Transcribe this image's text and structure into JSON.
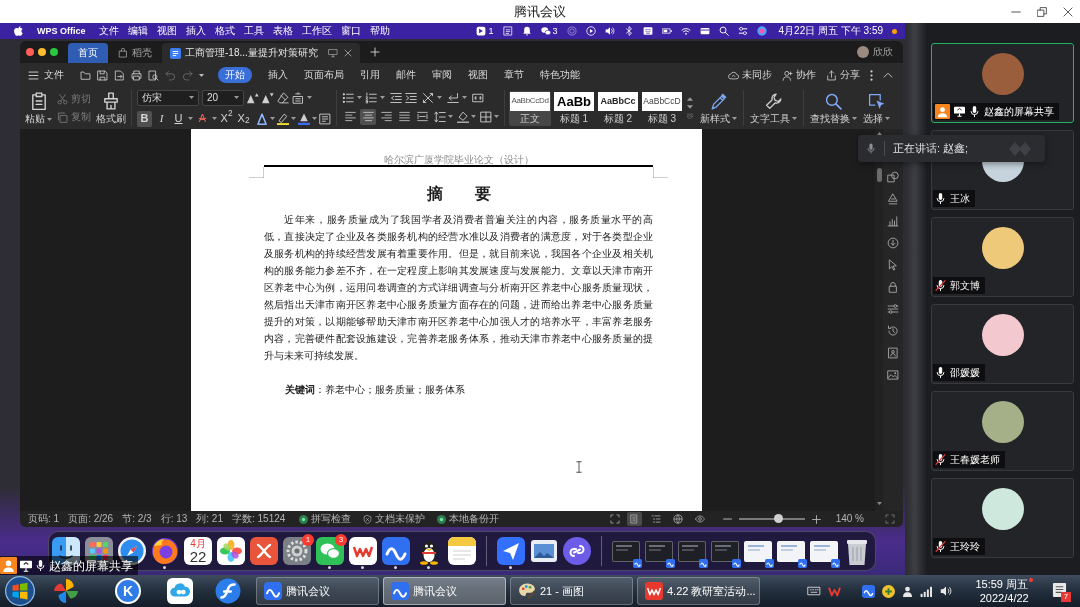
{
  "window": {
    "title": "腾讯会议"
  },
  "mac_menu_bar": {
    "app": "WPS Office",
    "menus": [
      "文件",
      "编辑",
      "视图",
      "插入",
      "格式",
      "工具",
      "表格",
      "工作区",
      "窗口",
      "帮助"
    ],
    "status_items": [
      {
        "kind": "app",
        "count": "1"
      },
      {
        "kind": "document"
      },
      {
        "kind": "bell"
      },
      {
        "kind": "chat",
        "count": "3"
      },
      {
        "kind": "spiral"
      },
      {
        "kind": "play"
      },
      {
        "kind": "volume"
      },
      {
        "kind": "bluetooth"
      },
      {
        "kind": "grid"
      },
      {
        "kind": "battery"
      },
      {
        "kind": "wifi"
      },
      {
        "kind": "card"
      },
      {
        "kind": "search"
      },
      {
        "kind": "toggles"
      },
      {
        "kind": "orb"
      }
    ],
    "clock": "4月22日 周五 下午 3:59"
  },
  "wps": {
    "tabs": [
      {
        "kind": "home",
        "label": "首页",
        "selected": false
      },
      {
        "kind": "shell",
        "label": "稻壳",
        "selected": false
      },
      {
        "kind": "doc",
        "label": "工商管理-18...量提升对策研究",
        "selected": true
      }
    ],
    "user": "欣欣",
    "file_menu": "文件",
    "ribbon_tabs": [
      {
        "label": "开始",
        "selected": true
      },
      {
        "label": "插入",
        "selected": false
      },
      {
        "label": "页面布局",
        "selected": false
      },
      {
        "label": "引用",
        "selected": false
      },
      {
        "label": "邮件",
        "selected": false
      },
      {
        "label": "审阅",
        "selected": false
      },
      {
        "label": "视图",
        "selected": false
      },
      {
        "label": "章节",
        "selected": false
      },
      {
        "label": "特色功能",
        "selected": false
      }
    ],
    "actions": [
      {
        "kind": "sync",
        "label": "未同步"
      },
      {
        "kind": "collab",
        "label": "协作"
      },
      {
        "kind": "share",
        "label": "分享"
      }
    ],
    "clipboard": [
      {
        "kind": "paste",
        "label": "粘贴",
        "disabled": false
      },
      {
        "kind": "cut",
        "label": "剪切",
        "disabled": true
      },
      {
        "kind": "copy",
        "label": "复制",
        "disabled": true
      },
      {
        "kind": "painter",
        "label": "格式刷",
        "disabled": false
      }
    ],
    "font": {
      "family": "仿宋",
      "size": "20"
    },
    "format_buttons": [
      {
        "kind": "bold",
        "text": "B",
        "selected": true
      },
      {
        "kind": "italic",
        "text": "I",
        "selected": false
      },
      {
        "kind": "underline",
        "text": "U",
        "selected": false
      },
      {
        "kind": "strike",
        "text": "A",
        "selected": false
      },
      {
        "kind": "sup",
        "text": "X$^{2}$",
        "selected": false
      },
      {
        "kind": "sub",
        "text": "X$_{2}$",
        "selected": false
      }
    ],
    "align_buttons": [
      {
        "kind": "left",
        "selected": false
      },
      {
        "kind": "center",
        "selected": true
      },
      {
        "kind": "right",
        "selected": false
      },
      {
        "kind": "justify",
        "selected": false
      },
      {
        "kind": "distributed",
        "selected": false
      }
    ],
    "styles": [
      {
        "kind": "body",
        "preview": "AaBbCcDd",
        "label": "正文",
        "selected": true
      },
      {
        "kind": "heading1",
        "preview": "AaBb",
        "label": "标题 1",
        "selected": false
      },
      {
        "kind": "heading2",
        "preview": "AaBbCc",
        "label": "标题 2",
        "selected": false
      },
      {
        "kind": "heading3",
        "preview": "AaBbCcD",
        "label": "标题 3",
        "selected": false
      }
    ],
    "tools": [
      {
        "kind": "new_style",
        "label": "新样式"
      },
      {
        "kind": "text_tools",
        "label": "文字工具"
      },
      {
        "kind": "find",
        "label": "查找替换"
      },
      {
        "kind": "select",
        "label": "选择"
      }
    ],
    "document": {
      "header": "哈尔滨广厦学院毕业论文（设计）",
      "title": "摘　　要",
      "abstract": "近年来，服务质量成为了我国学者及消费者普遍关注的内容，服务质量水平的高低，直接决定了企业及各类服务机构的经营水准以及消费者的满意度，对于各类型企业及服务机构的持续经营发展有着重要作用。但是，就目前来说，我国各个企业及相关机构的服务能力参差不齐，在一定程度上影响其发展速度与发展能力。文章以天津市南开区养老中心为例，运用问卷调查的方式详细调查与分析南开区养老中心服务质量现状，然后指出天津市南开区养老中心服务质量方面存在的问题，进而给出养老中心服务质量提升的对策，以期能够帮助天津市南开区养老中心加强人才的培养水平，丰富养老服务内容，完善硬件配套设施建设，完善养老服务体系，推动天津市养老中心服务质量的提升与未来可持续发展。",
      "keywords": "**关键词**：养老中心；服务质量；服务体系"
    },
    "status_bar": {
      "fields": [
        "页码: 1",
        "页面: 2/26",
        "节: 2/3",
        "行: 13",
        "列: 21",
        "字数: 15124"
      ],
      "indicators": [
        {
          "kind": "spell",
          "label": "拼写检查"
        },
        {
          "kind": "protect",
          "label": "文档未保护"
        },
        {
          "kind": "backup",
          "label": "本地备份开"
        }
      ],
      "views": [
        {
          "kind": "page",
          "selected": true
        },
        {
          "kind": "outline",
          "selected": false
        },
        {
          "kind": "web",
          "selected": false
        },
        {
          "kind": "eye",
          "selected": false
        }
      ],
      "zoom": {
        "level": 0.6,
        "reading": "140 %"
      }
    }
  },
  "dock": {
    "sections": [
      [
        {
          "kind": "finder",
          "running": false
        },
        {
          "kind": "launchpad",
          "running": false
        },
        {
          "kind": "safari",
          "running": false
        },
        {
          "kind": "firefox",
          "running": true
        },
        {
          "kind": "calendar",
          "month": "4月",
          "day": "22",
          "running": false
        },
        {
          "kind": "photos",
          "running": false
        },
        {
          "kind": "mindmap",
          "running": false
        },
        {
          "kind": "settings",
          "badge": "1",
          "running": false
        },
        {
          "kind": "wechat",
          "badge": "3",
          "running": true
        },
        {
          "kind": "wps",
          "running": true
        },
        {
          "kind": "meeting",
          "running": true
        },
        {
          "kind": "qq",
          "running": true
        },
        {
          "kind": "notes",
          "running": false
        }
      ],
      [
        {
          "kind": "feishu",
          "running": true
        },
        {
          "kind": "preview",
          "running": false
        },
        {
          "kind": "miniapp",
          "running": false
        }
      ],
      [
        {
          "kind": "dark_window",
          "running": false
        },
        {
          "kind": "dark_window",
          "running": false
        },
        {
          "kind": "dark_window",
          "running": false
        },
        {
          "kind": "dark_window",
          "running": false
        },
        {
          "kind": "light_window",
          "running": false
        },
        {
          "kind": "light_window",
          "running": false
        },
        {
          "kind": "light_window",
          "running": false
        },
        {
          "kind": "trash",
          "running": false
        }
      ]
    ]
  },
  "screen_share_label": "赵鑫的屏幕共享",
  "speaking_notice": "正在讲话: 赵鑫;",
  "participants": [
    {
      "name": "赵鑫的屏幕共享",
      "color": "#9b5e3c",
      "host": true,
      "sharing": true,
      "muted": false,
      "speaking": true
    },
    {
      "name": "王冰",
      "color": "#c7d3dc",
      "host": false,
      "sharing": false,
      "muted": false,
      "speaking": false
    },
    {
      "name": "郭文博",
      "color": "#efc97a",
      "host": false,
      "sharing": false,
      "muted": true,
      "speaking": false
    },
    {
      "name": "邵媛媛",
      "color": "#f3c8ce",
      "host": false,
      "sharing": false,
      "muted": false,
      "speaking": false
    },
    {
      "name": "王春媛老师",
      "color": "#a5b088",
      "host": false,
      "sharing": false,
      "muted": true,
      "speaking": false
    },
    {
      "name": "王玲玲",
      "color": "#cfe8dd",
      "host": false,
      "sharing": false,
      "muted": true,
      "speaking": false
    }
  ],
  "taskbar": {
    "pinned": [
      {
        "kind": "pinwheel"
      },
      {
        "kind": "letter",
        "text": "K"
      },
      {
        "kind": "cloud"
      },
      {
        "kind": "swirl"
      }
    ],
    "tasks": [
      {
        "kind": "meeting",
        "label": "腾讯会议",
        "selected": false
      },
      {
        "kind": "meeting",
        "label": "腾讯会议",
        "selected": true
      },
      {
        "kind": "paint",
        "label": "21 - 画图",
        "selected": false
      },
      {
        "kind": "wps",
        "label": "4.22 教研室活动...",
        "selected": false
      }
    ],
    "time": "15:59 周五",
    "date": "2022/4/22",
    "notification_count": "7"
  }
}
